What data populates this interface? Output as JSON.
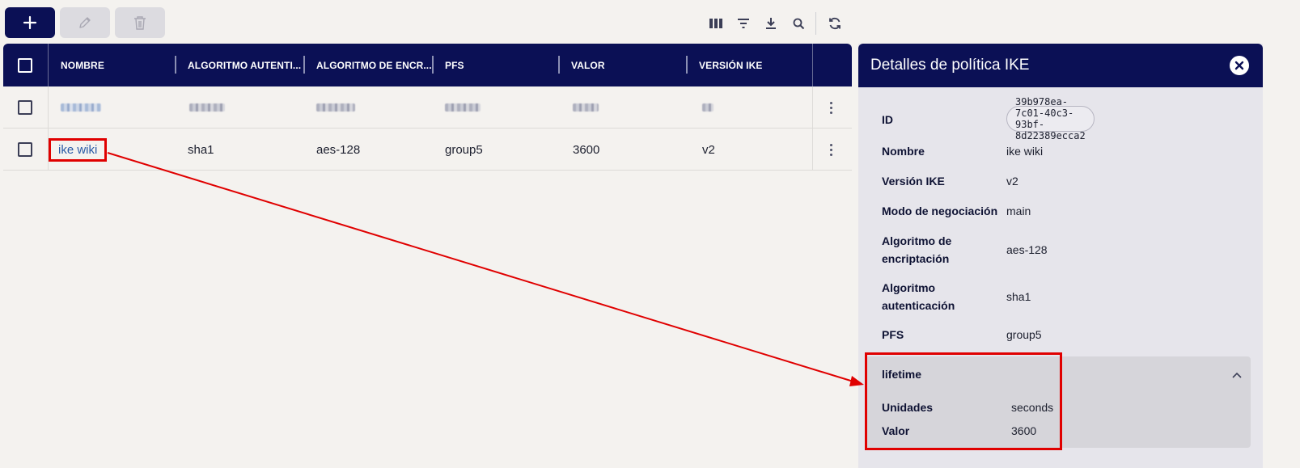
{
  "toolbar": {
    "buttons": [
      {
        "name": "add",
        "icon": "plus-icon",
        "enabled": true
      },
      {
        "name": "edit",
        "icon": "pencil-icon",
        "enabled": false
      },
      {
        "name": "delete",
        "icon": "trash-icon",
        "enabled": false
      }
    ],
    "right_icons": [
      "columns-icon",
      "filter-icon",
      "download-icon",
      "search-icon",
      "refresh-icon"
    ]
  },
  "table": {
    "columns": [
      "NOMBRE",
      "ALGORITMO AUTENTI...",
      "ALGORITMO DE ENCR...",
      "PFS",
      "VALOR",
      "VERSIÓN IKE"
    ],
    "rows": [
      {
        "redacted": true,
        "cells": [
          "",
          "",
          "",
          "",
          "",
          ""
        ]
      },
      {
        "redacted": false,
        "cells": [
          "ike wiki",
          "sha1",
          "aes-128",
          "group5",
          "3600",
          "v2"
        ]
      }
    ]
  },
  "panel": {
    "title": "Detalles de política IKE",
    "fields": [
      {
        "key": "ID",
        "value": "39b978ea-7c01-40c3-93bf-8d22389ecca2"
      },
      {
        "key": "Nombre",
        "value": "ike wiki"
      },
      {
        "key": "Versión IKE",
        "value": "v2"
      },
      {
        "key": "Modo de negociación",
        "value": "main"
      },
      {
        "key": "Algoritmo de encriptación",
        "value": "aes-128"
      },
      {
        "key": "Algoritmo autenticación",
        "value": "sha1"
      },
      {
        "key": "PFS",
        "value": "group5"
      }
    ],
    "lifetime": {
      "title": "lifetime",
      "fields": [
        {
          "key": "Unidades",
          "value": "seconds"
        },
        {
          "key": "Valor",
          "value": "3600"
        }
      ]
    }
  },
  "colors": {
    "navy": "#0b1055",
    "annotation_red": "#e00000",
    "link": "#2a5aa6"
  }
}
